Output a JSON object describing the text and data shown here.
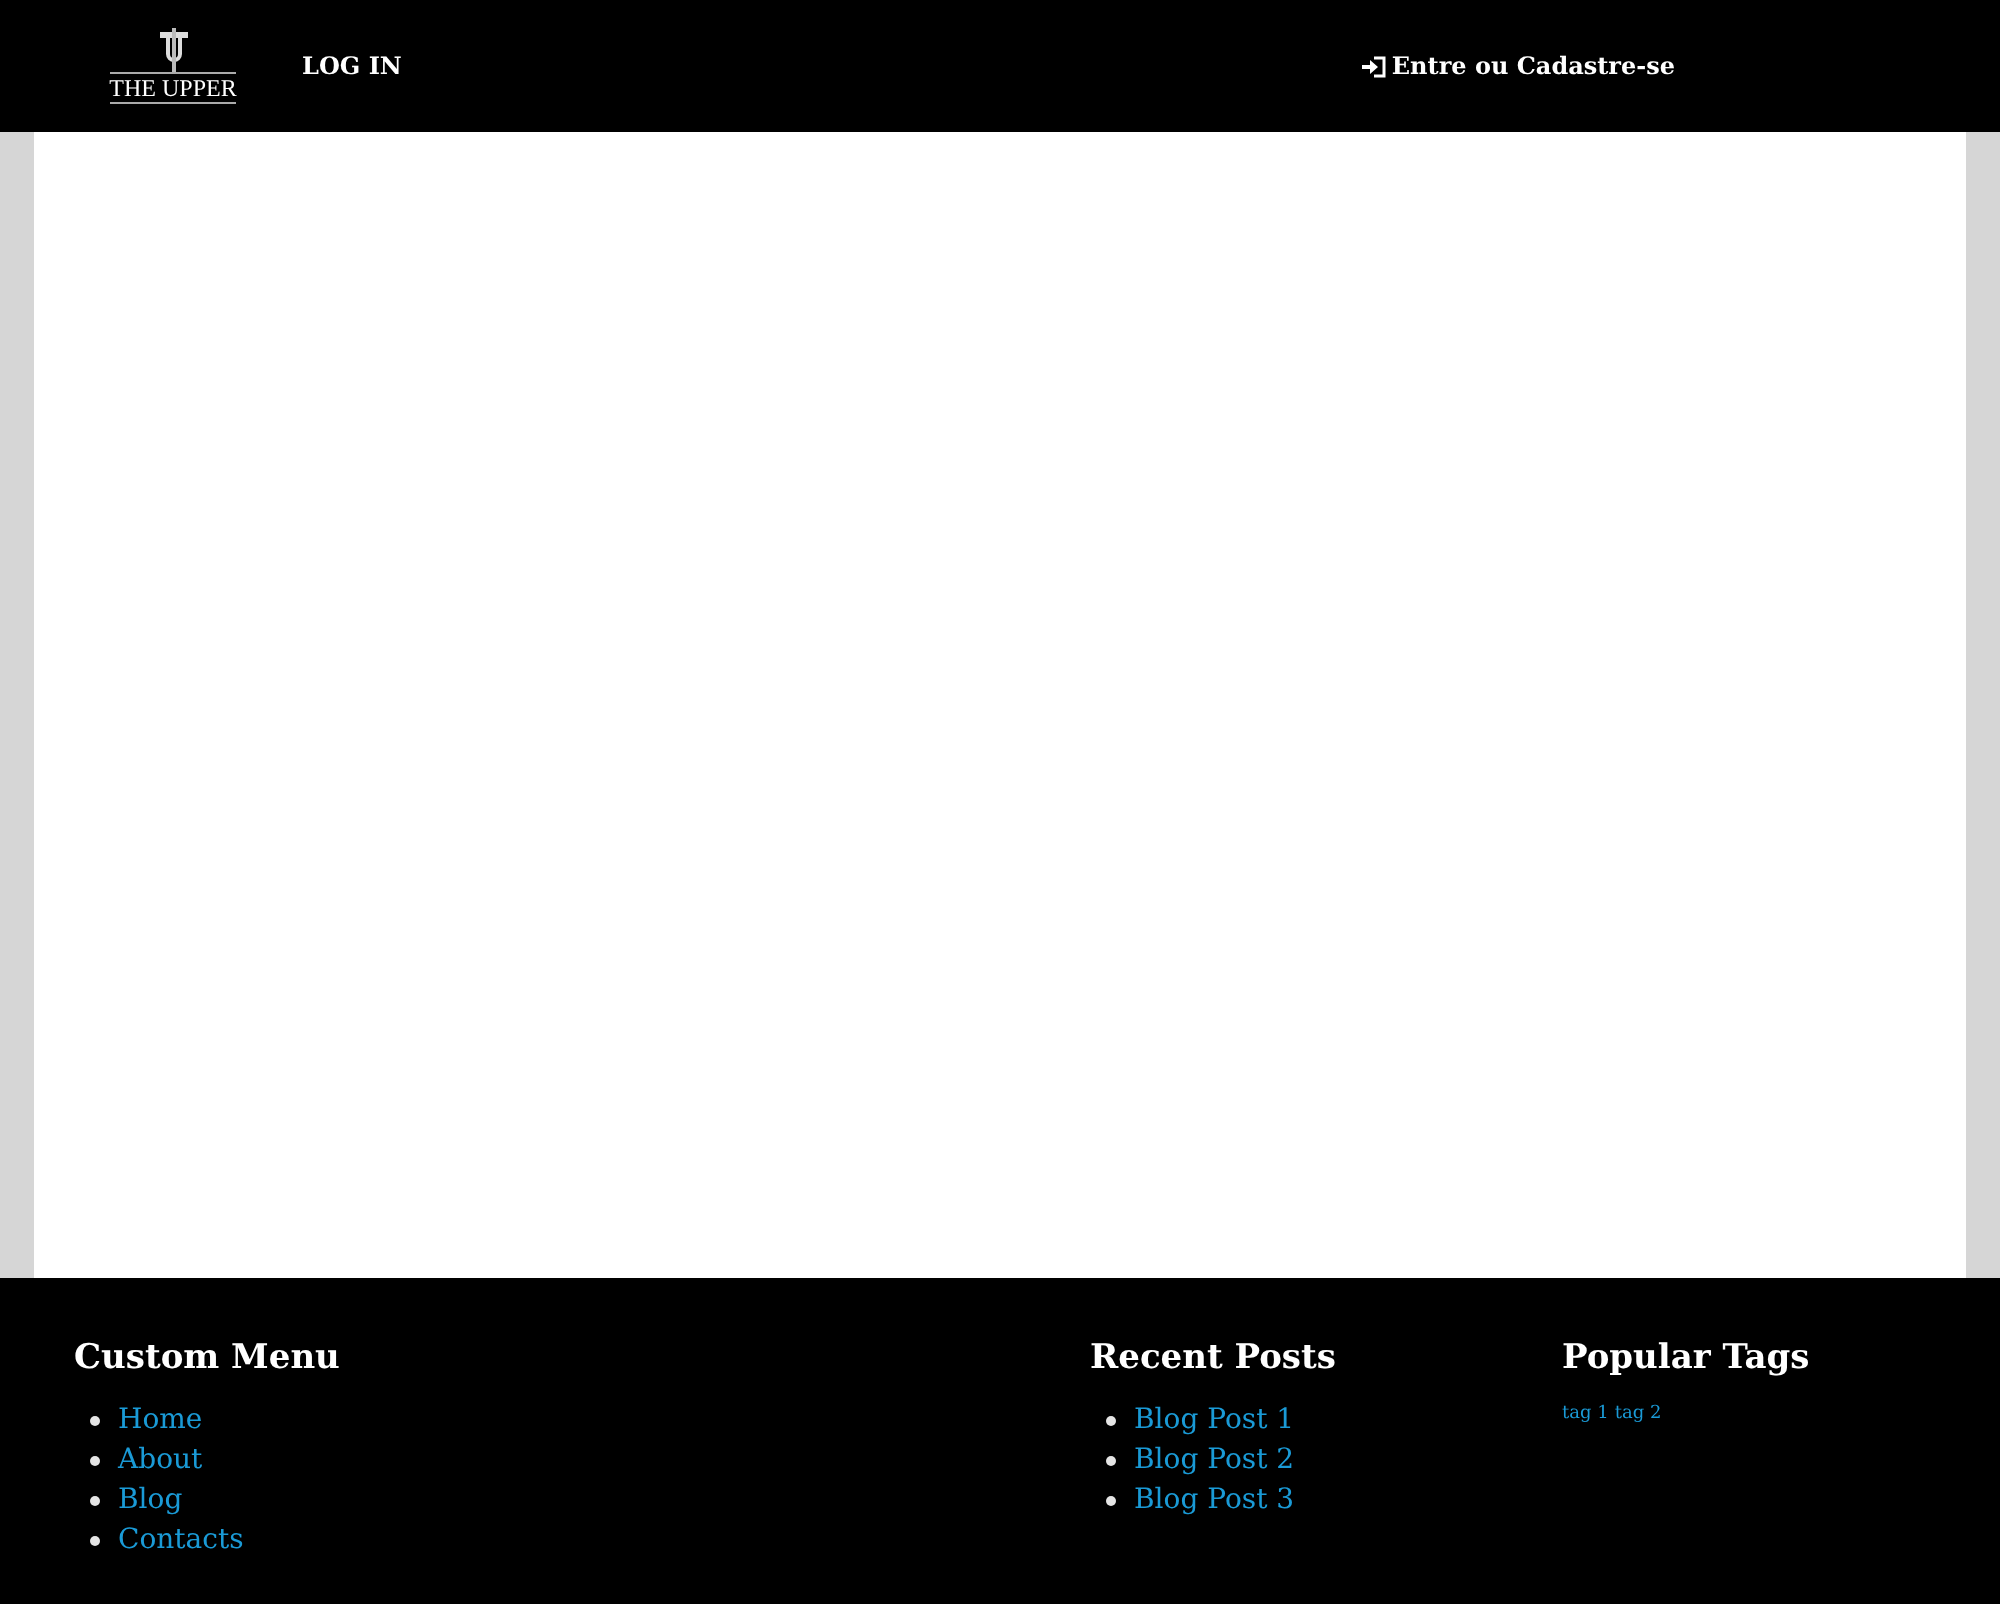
{
  "header": {
    "logo_text": "THE UPPER",
    "nav": [
      {
        "label": "LOG IN"
      }
    ],
    "login_link": "Entre ou Cadastre-se"
  },
  "footer": {
    "columns": [
      {
        "kind": "list",
        "title": "Custom Menu",
        "items": [
          "Home",
          "About",
          "Blog",
          "Contacts"
        ]
      },
      {
        "kind": "list",
        "title": "Recent Posts",
        "items": [
          "Blog Post 1",
          "Blog Post 2",
          "Blog Post 3"
        ]
      },
      {
        "kind": "tags",
        "title": "Popular Tags",
        "items": [
          "tag 1",
          "tag 2"
        ]
      }
    ]
  }
}
